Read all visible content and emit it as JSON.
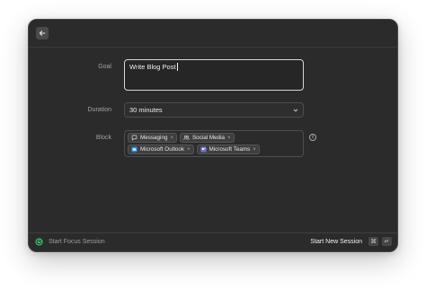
{
  "form": {
    "goal_label": "Goal",
    "goal_value": "Write Blog Post",
    "duration_label": "Duration",
    "duration_value": "30 minutes",
    "block_label": "Block"
  },
  "block_chips": [
    {
      "label": "Messaging",
      "icon": "message-bubble-icon"
    },
    {
      "label": "Social Media",
      "icon": "social-people-icon"
    },
    {
      "label": "Microsoft Outlook",
      "icon": "outlook-app-icon"
    },
    {
      "label": "Microsoft Teams",
      "icon": "teams-app-icon"
    }
  ],
  "chip_remove_glyph": "×",
  "footer": {
    "left_label": "Start Focus Session",
    "primary_action": "Start New Session",
    "shortcut_keys": [
      "⌘",
      "↵"
    ]
  },
  "colors": {
    "window_bg": "#2b2b2b",
    "accent_green": "#3ecf72",
    "outlook_blue": "#1f8ad8",
    "teams_purple": "#6f6fc8"
  }
}
